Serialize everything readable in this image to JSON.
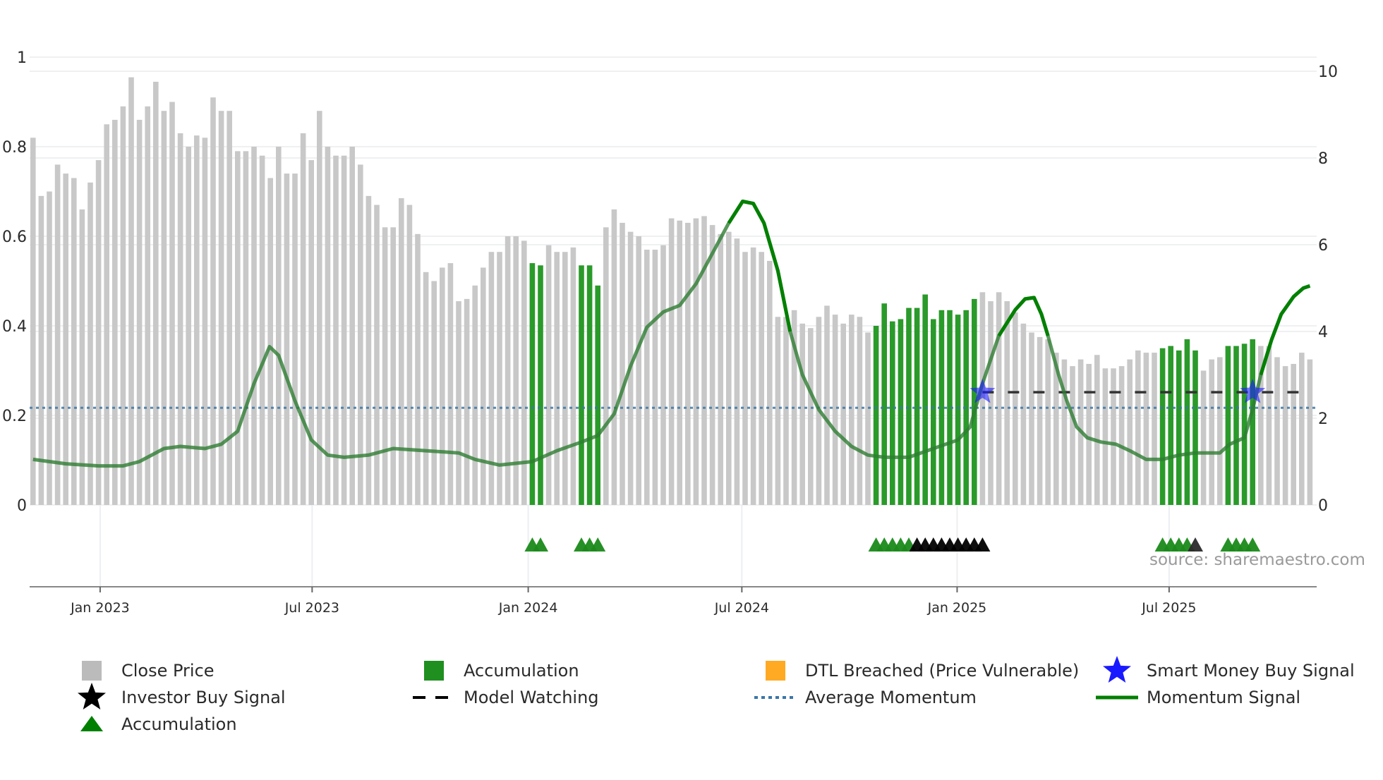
{
  "chart_data": {
    "type": "bar",
    "title": "",
    "xlabel": "",
    "ylabel_left": "",
    "ylabel_right": "",
    "left_axis": {
      "range": [
        0,
        1
      ],
      "ticks": [
        "0",
        "0.2",
        "0.4",
        "0.6",
        "0.8",
        "1"
      ],
      "tick_values": [
        0,
        0.2,
        0.4,
        0.6,
        0.8,
        1
      ]
    },
    "right_axis": {
      "range": [
        0,
        10
      ],
      "ticks": [
        "0",
        "2",
        "4",
        "6",
        "8",
        "10"
      ],
      "tick_values": [
        0,
        2,
        4,
        6,
        8,
        10
      ]
    },
    "x_ticks": [
      {
        "label": "Jan 2023",
        "week_index": 8.2
      },
      {
        "label": "Jul 2023",
        "week_index": 34.1
      },
      {
        "label": "Jan 2024",
        "week_index": 60.5
      },
      {
        "label": "Jul 2024",
        "week_index": 86.6
      },
      {
        "label": "Jan 2025",
        "week_index": 112.9
      },
      {
        "label": "Jul 2025",
        "week_index": 138.8
      }
    ],
    "close_price": [
      0.82,
      0.69,
      0.7,
      0.76,
      0.74,
      0.73,
      0.66,
      0.72,
      0.77,
      0.85,
      0.86,
      0.89,
      0.955,
      0.86,
      0.89,
      0.945,
      0.88,
      0.9,
      0.83,
      0.8,
      0.825,
      0.82,
      0.91,
      0.88,
      0.88,
      0.79,
      0.79,
      0.8,
      0.78,
      0.73,
      0.8,
      0.74,
      0.74,
      0.83,
      0.77,
      0.88,
      0.8,
      0.78,
      0.78,
      0.8,
      0.76,
      0.69,
      0.67,
      0.62,
      0.62,
      0.685,
      0.67,
      0.605,
      0.52,
      0.5,
      0.53,
      0.54,
      0.455,
      0.46,
      0.49,
      0.53,
      0.565,
      0.565,
      0.6,
      0.6,
      0.59,
      0.54,
      0.535,
      0.58,
      0.565,
      0.565,
      0.575,
      0.535,
      0.535,
      0.49,
      0.62,
      0.66,
      0.63,
      0.61,
      0.6,
      0.57,
      0.57,
      0.58,
      0.64,
      0.635,
      0.63,
      0.64,
      0.645,
      0.625,
      0.605,
      0.61,
      0.595,
      0.565,
      0.575,
      0.565,
      0.545,
      0.42,
      0.42,
      0.435,
      0.405,
      0.395,
      0.42,
      0.445,
      0.425,
      0.405,
      0.425,
      0.42,
      0.385,
      0.4,
      0.45,
      0.41,
      0.415,
      0.44,
      0.44,
      0.47,
      0.415,
      0.435,
      0.435,
      0.425,
      0.435,
      0.46,
      0.475,
      0.455,
      0.475,
      0.455,
      0.43,
      0.405,
      0.385,
      0.375,
      0.37,
      0.34,
      0.325,
      0.31,
      0.325,
      0.315,
      0.335,
      0.305,
      0.305,
      0.31,
      0.325,
      0.345,
      0.34,
      0.34,
      0.35,
      0.355,
      0.345,
      0.37,
      0.345,
      0.3,
      0.325,
      0.33,
      0.355,
      0.355,
      0.36,
      0.37,
      0.355,
      0.355,
      0.33,
      0.31,
      0.315,
      0.34,
      0.325
    ],
    "accumulation_bar_ranges": [
      [
        61,
        62
      ],
      [
        67,
        69
      ],
      [
        103,
        115
      ],
      [
        138,
        142
      ],
      [
        146,
        149
      ]
    ],
    "momentum_signal": [
      [
        0,
        1.05
      ],
      [
        4,
        0.95
      ],
      [
        8,
        0.9
      ],
      [
        11,
        0.9
      ],
      [
        13,
        1.0
      ],
      [
        16,
        1.3
      ],
      [
        18,
        1.35
      ],
      [
        21,
        1.3
      ],
      [
        23,
        1.4
      ],
      [
        25,
        1.7
      ],
      [
        27,
        2.8
      ],
      [
        28.9,
        3.65
      ],
      [
        30,
        3.45
      ],
      [
        32,
        2.4
      ],
      [
        34,
        1.5
      ],
      [
        36,
        1.15
      ],
      [
        38,
        1.1
      ],
      [
        41,
        1.15
      ],
      [
        44,
        1.3
      ],
      [
        48,
        1.25
      ],
      [
        52,
        1.2
      ],
      [
        54,
        1.05
      ],
      [
        57,
        0.92
      ],
      [
        61,
        1.0
      ],
      [
        64,
        1.25
      ],
      [
        67,
        1.45
      ],
      [
        69,
        1.6
      ],
      [
        71,
        2.1
      ],
      [
        73,
        3.2
      ],
      [
        75,
        4.1
      ],
      [
        77,
        4.45
      ],
      [
        79,
        4.6
      ],
      [
        81,
        5.1
      ],
      [
        83,
        5.8
      ],
      [
        85,
        6.5
      ],
      [
        86.7,
        7.0
      ],
      [
        88,
        6.95
      ],
      [
        89.3,
        6.5
      ],
      [
        91,
        5.4
      ],
      [
        92.5,
        4.0
      ],
      [
        94,
        3.0
      ],
      [
        96,
        2.2
      ],
      [
        98,
        1.7
      ],
      [
        100,
        1.35
      ],
      [
        102,
        1.15
      ],
      [
        104,
        1.1
      ],
      [
        107,
        1.1
      ],
      [
        110,
        1.3
      ],
      [
        113,
        1.5
      ],
      [
        114.5,
        1.8
      ],
      [
        116,
        2.8
      ],
      [
        118,
        3.9
      ],
      [
        120,
        4.5
      ],
      [
        121.2,
        4.75
      ],
      [
        122.3,
        4.78
      ],
      [
        123.2,
        4.4
      ],
      [
        124,
        3.9
      ],
      [
        125.3,
        3.0
      ],
      [
        126.3,
        2.4
      ],
      [
        127.5,
        1.8
      ],
      [
        128.8,
        1.55
      ],
      [
        130.5,
        1.45
      ],
      [
        132.3,
        1.4
      ],
      [
        134,
        1.25
      ],
      [
        136,
        1.05
      ],
      [
        138,
        1.05
      ],
      [
        140,
        1.15
      ],
      [
        142,
        1.2
      ],
      [
        145,
        1.2
      ],
      [
        146.2,
        1.4
      ],
      [
        148,
        1.55
      ],
      [
        149,
        2.2
      ],
      [
        150,
        3.0
      ],
      [
        151.3,
        3.8
      ],
      [
        152.5,
        4.4
      ],
      [
        154,
        4.8
      ],
      [
        155.2,
        5.0
      ],
      [
        156,
        5.05
      ]
    ],
    "momentum_highlight_ranges": [
      [
        84,
        92.5
      ],
      [
        118,
        124.5
      ],
      [
        150,
        156
      ]
    ],
    "average_momentum": 2.24,
    "model_watching": {
      "from_index": 116,
      "to_index": 156,
      "value": 2.6
    },
    "smart_money_buy_signals": [
      {
        "index": 116,
        "value": 2.6
      },
      {
        "index": 149,
        "value": 2.6
      }
    ],
    "accumulation_markers": [
      61,
      62,
      67,
      68,
      69,
      103,
      104,
      105,
      106,
      107,
      138,
      139,
      140,
      141,
      146,
      147,
      148,
      149
    ],
    "investor_buy_markers": [
      108,
      109,
      110,
      111,
      112,
      113,
      114,
      115,
      116,
      142
    ],
    "legend": [
      {
        "label": "Close Price",
        "icon": "gray-square"
      },
      {
        "label": "Accumulation",
        "icon": "green-square"
      },
      {
        "label": "DTL Breached (Price Vulnerable)",
        "icon": "orange-square"
      },
      {
        "label": "Smart Money Buy Signal",
        "icon": "blue-star"
      },
      {
        "label": "Investor Buy Signal",
        "icon": "black-star"
      },
      {
        "label": "Model Watching",
        "icon": "black-dashes"
      },
      {
        "label": "Average Momentum",
        "icon": "blue-dots"
      },
      {
        "label": "Momentum Signal",
        "icon": "green-line"
      },
      {
        "label": "Accumulation",
        "icon": "green-triangle"
      }
    ],
    "legend_placement": "bottom",
    "source": "source: sharemaestro.com",
    "colors": {
      "price": "#c8c8c8",
      "accumulation": "#2a9a2a",
      "dtl": "#ffaa22",
      "smart_money": "#1a1aff",
      "investor": "#000000",
      "momentum": "#2e7d32",
      "momentum_bright": "#008000",
      "average": "#3a77a8",
      "triangle": "#1a8a1a"
    }
  }
}
